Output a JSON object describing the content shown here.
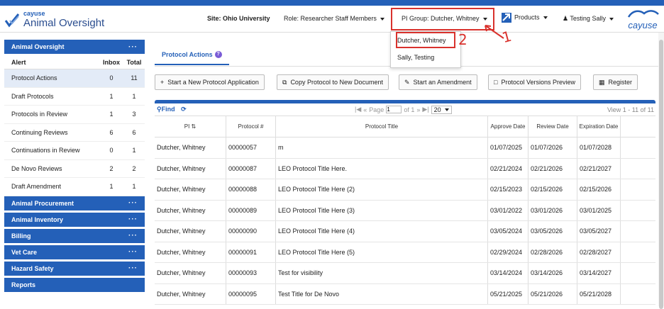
{
  "header": {
    "brand_small": "cayuse",
    "brand_big": "Animal Oversight",
    "site": "Site: Ohio University",
    "role": "Role: Researcher Staff Members",
    "pi_group": "PI Group: Dutcher, Whitney",
    "products": "Products",
    "user": "Testing Sally",
    "logo_text": "cayuse"
  },
  "pi_dropdown": {
    "options": [
      "Dutcher, Whitney",
      "Sally, Testing"
    ]
  },
  "annotations": {
    "mark1": "1",
    "mark2": "2"
  },
  "sidebar": {
    "title": "Animal Oversight",
    "cols": {
      "alert": "Alert",
      "inbox": "Inbox",
      "total": "Total"
    },
    "rows": [
      {
        "label": "Protocol Actions",
        "inbox": "0",
        "total": "11"
      },
      {
        "label": "Draft Protocols",
        "inbox": "1",
        "total": "1"
      },
      {
        "label": "Protocols in Review",
        "inbox": "1",
        "total": "3"
      },
      {
        "label": "Continuing Reviews",
        "inbox": "6",
        "total": "6"
      },
      {
        "label": "Continuations in Review",
        "inbox": "0",
        "total": "1"
      },
      {
        "label": "De Novo Reviews",
        "inbox": "2",
        "total": "2"
      },
      {
        "label": "Draft Amendment",
        "inbox": "1",
        "total": "1"
      }
    ],
    "sections": [
      "Animal Procurement",
      "Animal Inventory",
      "Billing",
      "Vet Care",
      "Hazard Safety",
      "Reports"
    ],
    "dots": "···"
  },
  "main": {
    "tab": "Protocol Actions",
    "buttons": [
      "Start a New Protocol Application",
      "Copy Protocol to New Document",
      "Start an Amendment",
      "Protocol Versions Preview",
      "Register"
    ],
    "find": "Find",
    "pager": {
      "page_label": "Page",
      "page": "1",
      "of": "of 1",
      "per_page": "20",
      "view": "View 1 - 11 of 11"
    },
    "columns": [
      "PI",
      "Protocol #",
      "Protocol Title",
      "Approve Date",
      "Review Date",
      "Expiration Date"
    ],
    "rows": [
      [
        "Dutcher, Whitney",
        "00000057",
        "m",
        "01/07/2025",
        "01/07/2026",
        "01/07/2028"
      ],
      [
        "Dutcher, Whitney",
        "00000087",
        "LEO Protocol Title Here.",
        "02/21/2024",
        "02/21/2026",
        "02/21/2027"
      ],
      [
        "Dutcher, Whitney",
        "00000088",
        "LEO Protocol Title Here (2)",
        "02/15/2023",
        "02/15/2026",
        "02/15/2026"
      ],
      [
        "Dutcher, Whitney",
        "00000089",
        "LEO Protocol Title Here (3)",
        "03/01/2022",
        "03/01/2026",
        "03/01/2025"
      ],
      [
        "Dutcher, Whitney",
        "00000090",
        "LEO Protocol Title Here (4)",
        "03/05/2024",
        "03/05/2026",
        "03/05/2027"
      ],
      [
        "Dutcher, Whitney",
        "00000091",
        "LEO Protocol Title Here (5)",
        "02/29/2024",
        "02/28/2026",
        "02/28/2027"
      ],
      [
        "Dutcher, Whitney",
        "00000093",
        "Test for visibility",
        "03/14/2024",
        "03/14/2026",
        "03/14/2027"
      ],
      [
        "Dutcher, Whitney",
        "00000095",
        "Test Title for De Novo",
        "05/21/2025",
        "05/21/2026",
        "05/21/2028"
      ]
    ]
  }
}
